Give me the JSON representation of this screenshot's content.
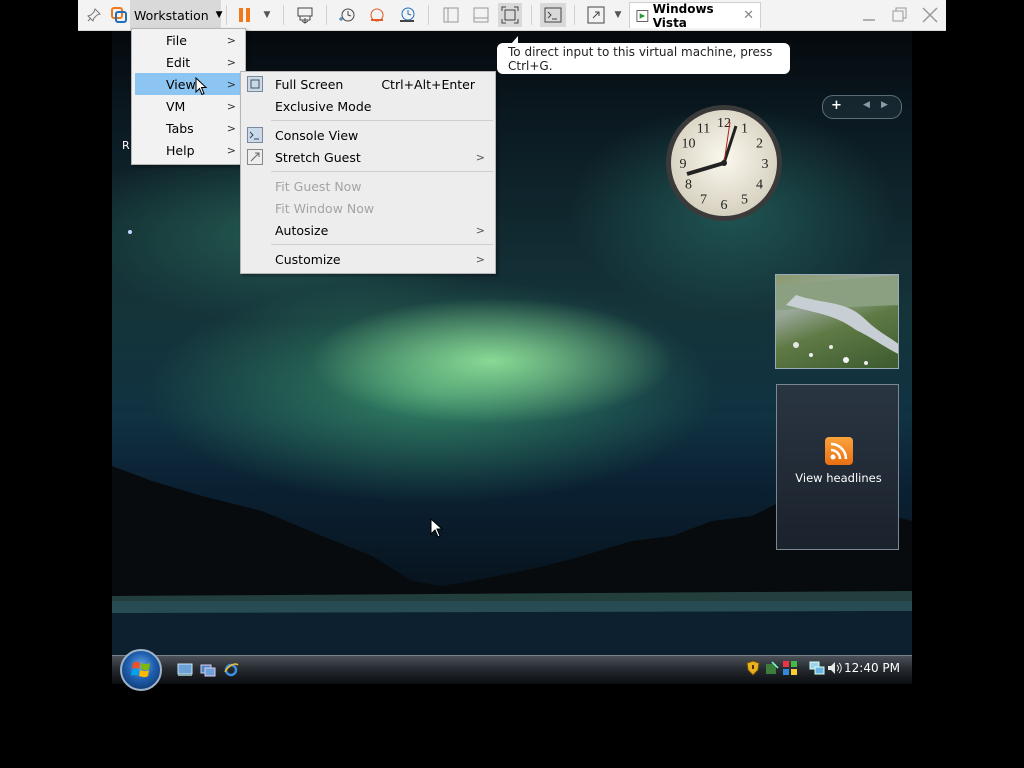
{
  "toolbar": {
    "app_menu_label": "Workstation",
    "tab_title": "Windows Vista",
    "tab_close": "✕",
    "icons": [
      "pin-icon",
      "vmware-logo-icon",
      "pause-icon",
      "send-ctrl-alt-del-icon",
      "snapshot-take-icon",
      "snapshot-revert-icon",
      "snapshot-manager-icon",
      "library-icon",
      "thumbnail-icon",
      "full-screen-icon",
      "console-view-icon",
      "stretch-icon",
      "minimize-icon",
      "restore-icon",
      "close-icon"
    ]
  },
  "workstation_menu": {
    "items": [
      {
        "label": "File"
      },
      {
        "label": "Edit"
      },
      {
        "label": "View"
      },
      {
        "label": "VM"
      },
      {
        "label": "Tabs"
      },
      {
        "label": "Help"
      }
    ],
    "active": "View"
  },
  "view_menu": {
    "items": [
      {
        "label": "Full Screen",
        "shortcut": "Ctrl+Alt+Enter"
      },
      {
        "label": "Exclusive Mode"
      },
      {
        "label": "Console View"
      },
      {
        "label": "Stretch Guest"
      },
      {
        "label": "Fit Guest Now"
      },
      {
        "label": "Fit Window Now"
      },
      {
        "label": "Autosize"
      },
      {
        "label": "Customize"
      }
    ]
  },
  "tooltip": {
    "text": "To direct input to this virtual machine, press Ctrl+G."
  },
  "desktop": {
    "partial_icon_label": "R",
    "feed_gadget_label": "View headlines",
    "clock_numbers": [
      "12",
      "1",
      "2",
      "3",
      "4",
      "5",
      "6",
      "7",
      "8",
      "9",
      "10",
      "11"
    ]
  },
  "taskbar": {
    "time": "12:40 PM"
  },
  "colors": {
    "toolbar_bg": "#f3f3f3",
    "menu_highlight": "#8cc4f2",
    "pause_orange": "#f07a1a",
    "disabled_text": "#a4a4a4"
  }
}
